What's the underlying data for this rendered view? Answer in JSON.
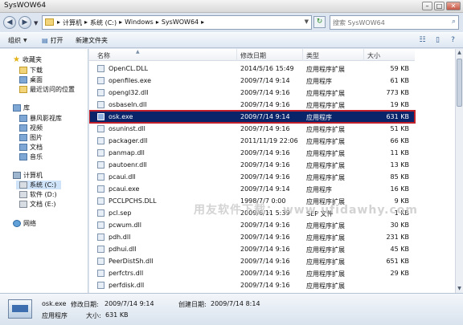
{
  "window": {
    "title": "SysWOW64",
    "buttons": [
      "minimize",
      "maximize",
      "close"
    ]
  },
  "nav": {
    "back": "back-icon",
    "forward": "forward-icon"
  },
  "address": {
    "breadcrumbs": [
      "计算机",
      "系统 (C:)",
      "Windows",
      "SysWOW64"
    ],
    "separator": "▸"
  },
  "search": {
    "placeholder": "搜索 SysWOW64"
  },
  "toolbar": {
    "organize": "组织",
    "open": "打开",
    "new_folder": "新建文件夹"
  },
  "sidebar": {
    "favorites": {
      "label": "收藏夹",
      "items": [
        "下载",
        "桌面",
        "最近访问的位置"
      ]
    },
    "libraries": {
      "label": "库",
      "items": [
        "暴风影视库",
        "视频",
        "图片",
        "文档",
        "音乐"
      ]
    },
    "computer": {
      "label": "计算机",
      "items": [
        "系统 (C:)",
        "软件 (D:)",
        "文档 (E:)"
      ],
      "selected": "系统 (C:)"
    },
    "network": {
      "label": "网络"
    }
  },
  "columns": {
    "name": "名称",
    "date": "修改日期",
    "type": "类型",
    "size": "大小"
  },
  "files": [
    {
      "name": "OpenCL.DLL",
      "date": "2014/5/16 15:49",
      "type": "应用程序扩展",
      "size": "59 KB"
    },
    {
      "name": "openfiles.exe",
      "date": "2009/7/14 9:14",
      "type": "应用程序",
      "size": "61 KB"
    },
    {
      "name": "opengl32.dll",
      "date": "2009/7/14 9:16",
      "type": "应用程序扩展",
      "size": "773 KB"
    },
    {
      "name": "osbaseln.dll",
      "date": "2009/7/14 9:16",
      "type": "应用程序扩展",
      "size": "19 KB"
    },
    {
      "name": "osk.exe",
      "date": "2009/7/14 9:14",
      "type": "应用程序",
      "size": "631 KB",
      "selected": true
    },
    {
      "name": "osuninst.dll",
      "date": "2009/7/14 9:16",
      "type": "应用程序扩展",
      "size": "51 KB"
    },
    {
      "name": "packager.dll",
      "date": "2011/11/19 22:06",
      "type": "应用程序扩展",
      "size": "66 KB"
    },
    {
      "name": "panmap.dll",
      "date": "2009/7/14 9:16",
      "type": "应用程序扩展",
      "size": "11 KB"
    },
    {
      "name": "pautoenr.dll",
      "date": "2009/7/14 9:16",
      "type": "应用程序扩展",
      "size": "13 KB"
    },
    {
      "name": "pcaui.dll",
      "date": "2009/7/14 9:16",
      "type": "应用程序扩展",
      "size": "85 KB"
    },
    {
      "name": "pcaui.exe",
      "date": "2009/7/14 9:14",
      "type": "应用程序",
      "size": "16 KB"
    },
    {
      "name": "PCCLPCHS.DLL",
      "date": "1998/7/7 0:00",
      "type": "应用程序扩展",
      "size": "9 KB"
    },
    {
      "name": "pcl.sep",
      "date": "2009/6/11 5:39",
      "type": "SEP 文件",
      "size": "1 KB"
    },
    {
      "name": "pcwum.dll",
      "date": "2009/7/14 9:16",
      "type": "应用程序扩展",
      "size": "30 KB"
    },
    {
      "name": "pdh.dll",
      "date": "2009/7/14 9:16",
      "type": "应用程序扩展",
      "size": "231 KB"
    },
    {
      "name": "pdhui.dll",
      "date": "2009/7/14 9:16",
      "type": "应用程序扩展",
      "size": "45 KB"
    },
    {
      "name": "PeerDistSh.dll",
      "date": "2009/7/14 9:16",
      "type": "应用程序扩展",
      "size": "651 KB"
    },
    {
      "name": "perfctrs.dll",
      "date": "2009/7/14 9:16",
      "type": "应用程序扩展",
      "size": "29 KB"
    },
    {
      "name": "perfdisk.dll",
      "date": "2009/7/14 9:16",
      "type": "应用程序扩展",
      "size": ""
    }
  ],
  "details": {
    "name": "osk.exe",
    "modified_label": "修改日期:",
    "modified": "2009/7/14 9:14",
    "created_label": "创建日期:",
    "created": "2009/7/14 8:14",
    "type": "应用程序",
    "size_label": "大小:",
    "size": "631 KB"
  },
  "watermark": "用友软件下载： www.ufidawhy.com",
  "colors": {
    "selection": "#0a246a",
    "selection_outline": "#c0202a",
    "nav_bg": "#dfe6ef"
  }
}
